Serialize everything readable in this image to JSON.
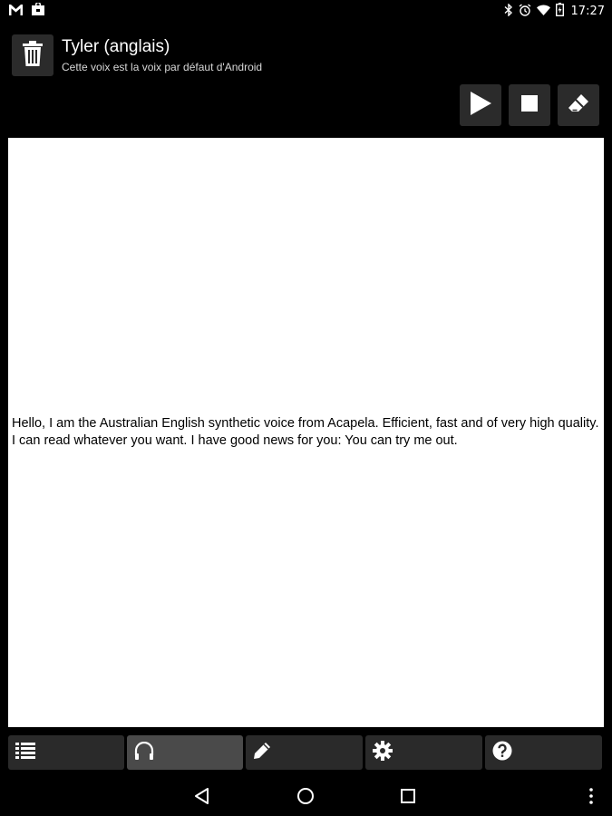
{
  "status_bar": {
    "time": "17:27",
    "left_icons": [
      "gmail-icon",
      "shopping-bag-icon"
    ],
    "right_icons": [
      "bluetooth-icon",
      "alarm-icon",
      "wifi-icon",
      "battery-icon"
    ]
  },
  "header": {
    "title": "Tyler (anglais)",
    "subtitle": "Cette voix est la voix par défaut d'Android"
  },
  "toolbar": {
    "buttons": [
      "play-icon",
      "stop-icon",
      "eraser-icon"
    ]
  },
  "editor": {
    "text": "Hello, I am the Australian English synthetic voice from Acapela. Efficient, fast and of very high quality. I can read whatever you want. I have good news for you: You can try me out."
  },
  "tabs": {
    "items": [
      "list-icon",
      "headphones-icon",
      "pencil-icon",
      "gear-icon",
      "help-icon"
    ],
    "active": "headphones-icon"
  },
  "colors": {
    "background": "#000000",
    "button_bg": "#2b2b2b",
    "active_tab_bg": "#4a4a4a",
    "text_area_bg": "#ffffff"
  }
}
